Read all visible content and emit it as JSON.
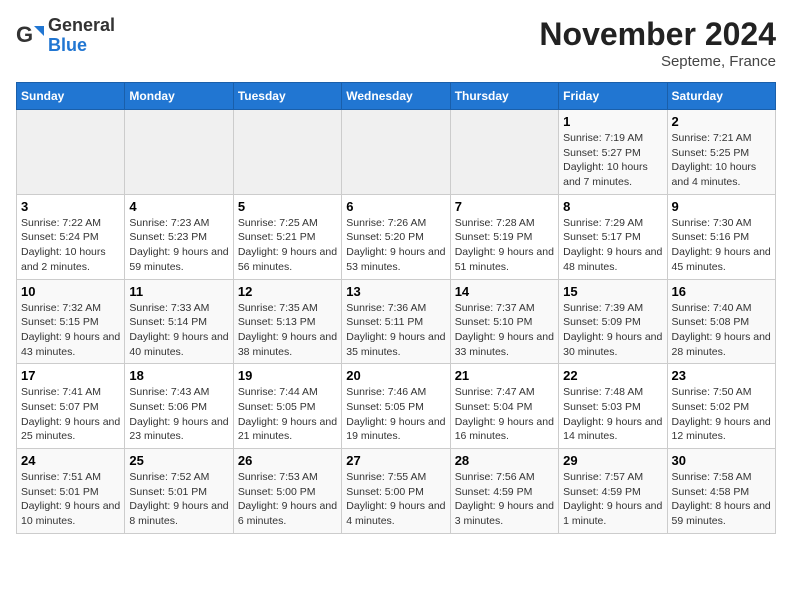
{
  "logo": {
    "general": "General",
    "blue": "Blue"
  },
  "header": {
    "month": "November 2024",
    "location": "Septeme, France"
  },
  "weekdays": [
    "Sunday",
    "Monday",
    "Tuesday",
    "Wednesday",
    "Thursday",
    "Friday",
    "Saturday"
  ],
  "weeks": [
    [
      {
        "day": "",
        "info": ""
      },
      {
        "day": "",
        "info": ""
      },
      {
        "day": "",
        "info": ""
      },
      {
        "day": "",
        "info": ""
      },
      {
        "day": "",
        "info": ""
      },
      {
        "day": "1",
        "info": "Sunrise: 7:19 AM\nSunset: 5:27 PM\nDaylight: 10 hours and 7 minutes."
      },
      {
        "day": "2",
        "info": "Sunrise: 7:21 AM\nSunset: 5:25 PM\nDaylight: 10 hours and 4 minutes."
      }
    ],
    [
      {
        "day": "3",
        "info": "Sunrise: 7:22 AM\nSunset: 5:24 PM\nDaylight: 10 hours and 2 minutes."
      },
      {
        "day": "4",
        "info": "Sunrise: 7:23 AM\nSunset: 5:23 PM\nDaylight: 9 hours and 59 minutes."
      },
      {
        "day": "5",
        "info": "Sunrise: 7:25 AM\nSunset: 5:21 PM\nDaylight: 9 hours and 56 minutes."
      },
      {
        "day": "6",
        "info": "Sunrise: 7:26 AM\nSunset: 5:20 PM\nDaylight: 9 hours and 53 minutes."
      },
      {
        "day": "7",
        "info": "Sunrise: 7:28 AM\nSunset: 5:19 PM\nDaylight: 9 hours and 51 minutes."
      },
      {
        "day": "8",
        "info": "Sunrise: 7:29 AM\nSunset: 5:17 PM\nDaylight: 9 hours and 48 minutes."
      },
      {
        "day": "9",
        "info": "Sunrise: 7:30 AM\nSunset: 5:16 PM\nDaylight: 9 hours and 45 minutes."
      }
    ],
    [
      {
        "day": "10",
        "info": "Sunrise: 7:32 AM\nSunset: 5:15 PM\nDaylight: 9 hours and 43 minutes."
      },
      {
        "day": "11",
        "info": "Sunrise: 7:33 AM\nSunset: 5:14 PM\nDaylight: 9 hours and 40 minutes."
      },
      {
        "day": "12",
        "info": "Sunrise: 7:35 AM\nSunset: 5:13 PM\nDaylight: 9 hours and 38 minutes."
      },
      {
        "day": "13",
        "info": "Sunrise: 7:36 AM\nSunset: 5:11 PM\nDaylight: 9 hours and 35 minutes."
      },
      {
        "day": "14",
        "info": "Sunrise: 7:37 AM\nSunset: 5:10 PM\nDaylight: 9 hours and 33 minutes."
      },
      {
        "day": "15",
        "info": "Sunrise: 7:39 AM\nSunset: 5:09 PM\nDaylight: 9 hours and 30 minutes."
      },
      {
        "day": "16",
        "info": "Sunrise: 7:40 AM\nSunset: 5:08 PM\nDaylight: 9 hours and 28 minutes."
      }
    ],
    [
      {
        "day": "17",
        "info": "Sunrise: 7:41 AM\nSunset: 5:07 PM\nDaylight: 9 hours and 25 minutes."
      },
      {
        "day": "18",
        "info": "Sunrise: 7:43 AM\nSunset: 5:06 PM\nDaylight: 9 hours and 23 minutes."
      },
      {
        "day": "19",
        "info": "Sunrise: 7:44 AM\nSunset: 5:05 PM\nDaylight: 9 hours and 21 minutes."
      },
      {
        "day": "20",
        "info": "Sunrise: 7:46 AM\nSunset: 5:05 PM\nDaylight: 9 hours and 19 minutes."
      },
      {
        "day": "21",
        "info": "Sunrise: 7:47 AM\nSunset: 5:04 PM\nDaylight: 9 hours and 16 minutes."
      },
      {
        "day": "22",
        "info": "Sunrise: 7:48 AM\nSunset: 5:03 PM\nDaylight: 9 hours and 14 minutes."
      },
      {
        "day": "23",
        "info": "Sunrise: 7:50 AM\nSunset: 5:02 PM\nDaylight: 9 hours and 12 minutes."
      }
    ],
    [
      {
        "day": "24",
        "info": "Sunrise: 7:51 AM\nSunset: 5:01 PM\nDaylight: 9 hours and 10 minutes."
      },
      {
        "day": "25",
        "info": "Sunrise: 7:52 AM\nSunset: 5:01 PM\nDaylight: 9 hours and 8 minutes."
      },
      {
        "day": "26",
        "info": "Sunrise: 7:53 AM\nSunset: 5:00 PM\nDaylight: 9 hours and 6 minutes."
      },
      {
        "day": "27",
        "info": "Sunrise: 7:55 AM\nSunset: 5:00 PM\nDaylight: 9 hours and 4 minutes."
      },
      {
        "day": "28",
        "info": "Sunrise: 7:56 AM\nSunset: 4:59 PM\nDaylight: 9 hours and 3 minutes."
      },
      {
        "day": "29",
        "info": "Sunrise: 7:57 AM\nSunset: 4:59 PM\nDaylight: 9 hours and 1 minute."
      },
      {
        "day": "30",
        "info": "Sunrise: 7:58 AM\nSunset: 4:58 PM\nDaylight: 8 hours and 59 minutes."
      }
    ]
  ]
}
